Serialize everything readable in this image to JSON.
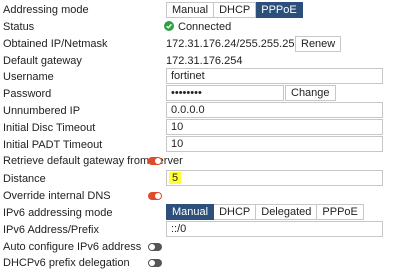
{
  "addressing_mode": {
    "label": "Addressing mode",
    "options": [
      "Manual",
      "DHCP",
      "PPPoE"
    ],
    "selected": "PPPoE"
  },
  "status": {
    "label": "Status",
    "value": "Connected",
    "icon": "check-circle-icon",
    "color": "#2ea043"
  },
  "obtained_ip": {
    "label": "Obtained IP/Netmask",
    "value": "172.31.176.24/255.255.255.255",
    "button": "Renew"
  },
  "default_gateway": {
    "label": "Default gateway",
    "value": "172.31.176.254"
  },
  "username": {
    "label": "Username",
    "value": "fortinet"
  },
  "password": {
    "label": "Password",
    "value": "••••••••",
    "button": "Change"
  },
  "unnumbered_ip": {
    "label": "Unnumbered IP",
    "value": "0.0.0.0"
  },
  "initial_disc_timeout": {
    "label": "Initial Disc Timeout",
    "value": "10"
  },
  "initial_padt_timeout": {
    "label": "Initial PADT Timeout",
    "value": "10"
  },
  "retrieve_gateway": {
    "label": "Retrieve default gateway from server",
    "enabled": true
  },
  "distance": {
    "label": "Distance",
    "value": "5",
    "highlight": "#ffff33"
  },
  "override_dns": {
    "label": "Override internal DNS",
    "enabled": true
  },
  "ipv6_mode": {
    "label": "IPv6 addressing mode",
    "options": [
      "Manual",
      "DHCP",
      "Delegated",
      "PPPoE"
    ],
    "selected": "Manual"
  },
  "ipv6_prefix": {
    "label": "IPv6 Address/Prefix",
    "value": "::/0"
  },
  "auto_ipv6": {
    "label": "Auto configure IPv6 address",
    "enabled": false
  },
  "dhcpv6_delegation": {
    "label": "DHCPv6 prefix delegation",
    "enabled": false
  },
  "colors": {
    "accent": "#2c4f7c",
    "toggle_on": "#e04b2a",
    "toggle_off": "#555555"
  }
}
